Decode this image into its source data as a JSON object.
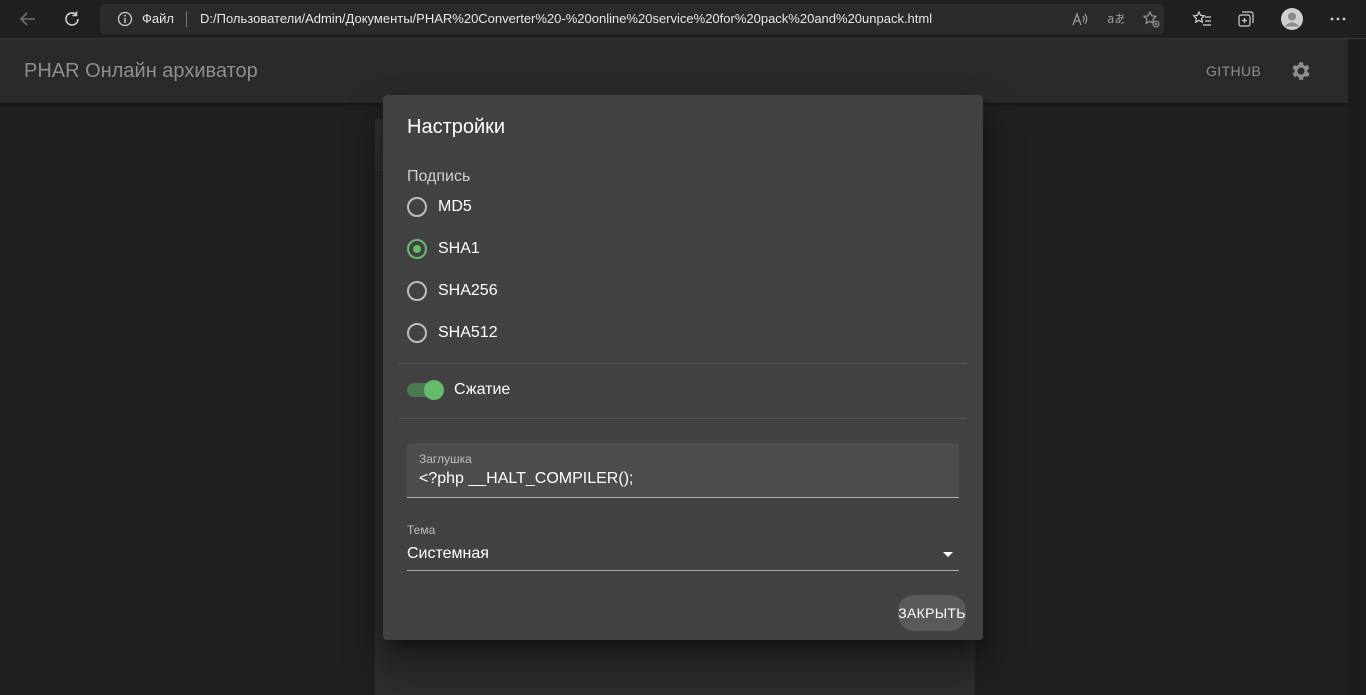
{
  "browser": {
    "address_scheme": "Файл",
    "url": "D:/Пользователи/Admin/Документы/PHAR%20Converter%20-%20online%20service%20for%20pack%20and%20unpack.html"
  },
  "app": {
    "title": "PHAR Онлайн архиватор",
    "github_label": "GITHUB"
  },
  "dialog": {
    "title": "Настройки",
    "signature_label": "Подпись",
    "signature_options": [
      {
        "label": "MD5",
        "selected": false
      },
      {
        "label": "SHA1",
        "selected": true
      },
      {
        "label": "SHA256",
        "selected": false
      },
      {
        "label": "SHA512",
        "selected": false
      }
    ],
    "compression_label": "Сжатие",
    "compression_enabled": true,
    "stub_label": "Заглушка",
    "stub_value": "<?php __HALT_COMPILER();",
    "theme_label": "Тема",
    "theme_value": "Системная",
    "close_label": "ЗАКРЫТЬ"
  },
  "colors": {
    "accent": "#66bb6a",
    "dialog_bg": "#424242",
    "page_bg": "#202020"
  },
  "icons": [
    "back-icon",
    "refresh-icon",
    "info-icon",
    "read-aloud-icon",
    "translate-icon",
    "add-favorite-icon",
    "favorites-icon",
    "collections-icon",
    "profile-icon",
    "more-icon",
    "gear-icon",
    "dropdown-arrow-icon"
  ]
}
